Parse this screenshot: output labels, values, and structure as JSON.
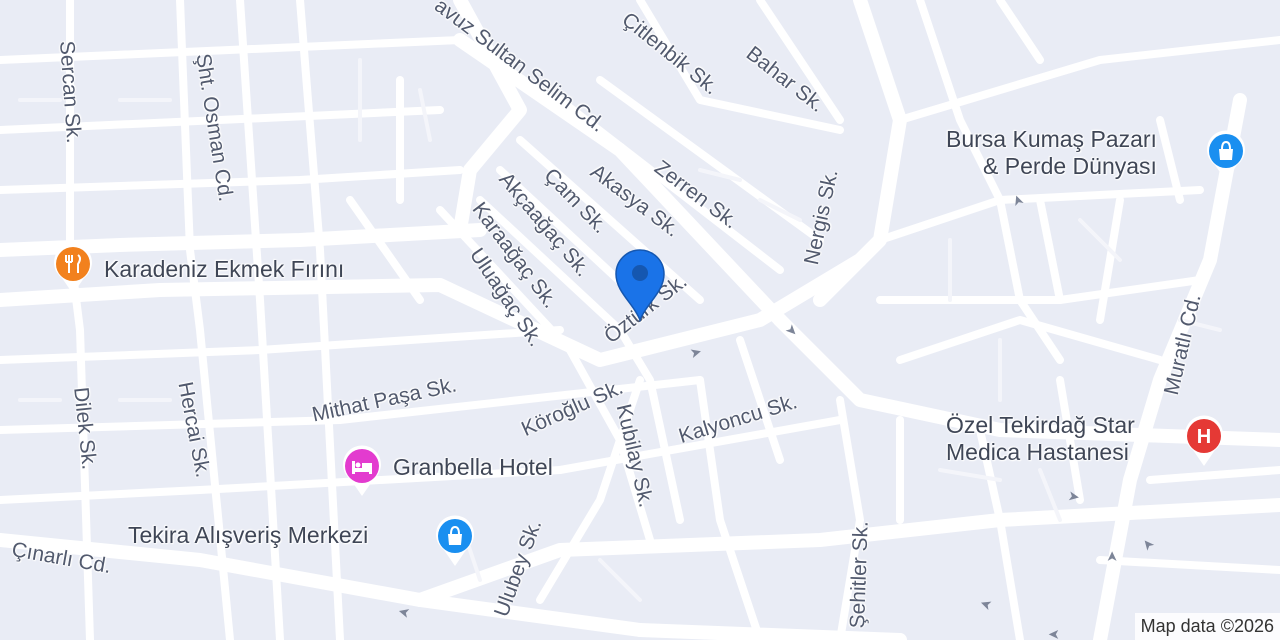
{
  "map": {
    "marker": {
      "icon": "location-pin-icon",
      "color": "#1a73e8"
    },
    "streets": [
      {
        "id": "yavuz",
        "label": "avuz Sultan Selim Cd."
      },
      {
        "id": "citlenbik",
        "label": "Çitlenbik Sk."
      },
      {
        "id": "bahar",
        "label": "Bahar Sk."
      },
      {
        "id": "sercan",
        "label": "Sercan Sk."
      },
      {
        "id": "osman",
        "label": "Şht. Osman Cd."
      },
      {
        "id": "akasya",
        "label": "Akasya Sk."
      },
      {
        "id": "zerren",
        "label": "Zerren Sk."
      },
      {
        "id": "nergis",
        "label": "Nergis Sk."
      },
      {
        "id": "cam",
        "label": "Çam Sk."
      },
      {
        "id": "akcaagac",
        "label": "Akçaağaç Sk."
      },
      {
        "id": "karaagac",
        "label": "Karaağaç Sk."
      },
      {
        "id": "uluagac",
        "label": "Uluağaç Sk."
      },
      {
        "id": "ozturk",
        "label": "Öztürk Sk."
      },
      {
        "id": "muratli",
        "label": "Muratlı Cd."
      },
      {
        "id": "mithat",
        "label": "Mithat Paşa Sk."
      },
      {
        "id": "koroglu",
        "label": "Köroğlu Sk."
      },
      {
        "id": "kalyoncu",
        "label": "Kalyoncu Sk."
      },
      {
        "id": "kubilay",
        "label": "Kubilay Sk."
      },
      {
        "id": "dilek",
        "label": "Dilek Sk."
      },
      {
        "id": "hercai",
        "label": "Hercai Sk."
      },
      {
        "id": "ulubey",
        "label": "Ulubey Sk."
      },
      {
        "id": "sehitler",
        "label": "Şehitler Sk."
      },
      {
        "id": "cinarli",
        "label": "Çınarlı Cd."
      }
    ],
    "pois": [
      {
        "id": "bursa",
        "label_line1": "Bursa Kumaş Pazarı",
        "label_line2": "& Perde Dünyası",
        "icon": "shopping-bag-icon",
        "color": "#1a8ff0"
      },
      {
        "id": "karadeniz",
        "label_line1": "Karadeniz Ekmek Fırını",
        "icon": "restaurant-icon",
        "color": "#f2811d"
      },
      {
        "id": "ozel",
        "label_line1": "Özel Tekirdağ Star",
        "label_line2": "Medica Hastanesi",
        "icon": "hospital-icon",
        "color": "#e53935"
      },
      {
        "id": "granbella",
        "label_line1": "Granbella Hotel",
        "icon": "hotel-bed-icon",
        "color": "#e33bcf"
      },
      {
        "id": "tekira",
        "label_line1": "Tekira Alışveriş Merkezi",
        "icon": "shopping-bag-icon",
        "color": "#1a8ff0"
      }
    ],
    "attribution": "Map data ©2026"
  }
}
